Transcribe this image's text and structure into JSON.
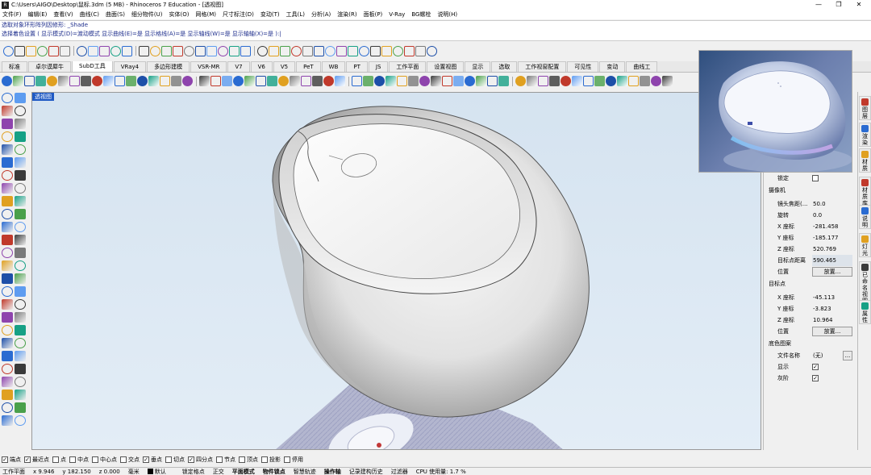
{
  "window": {
    "title": "C:\\Users\\AIGO\\Desktop\\鼠标.3dm (5 MB) - Rhinoceros 7 Education - [透视图]",
    "controls": [
      "—",
      "❐",
      "✕"
    ]
  },
  "menu": [
    "文件(F)",
    "编辑(E)",
    "查看(V)",
    "曲线(C)",
    "曲面(S)",
    "细分物件(U)",
    "实体(O)",
    "网格(M)",
    "尺寸标注(D)",
    "变动(T)",
    "工具(L)",
    "分析(A)",
    "渲染(R)",
    "面板(P)",
    "V-Ray",
    "BG螺栓",
    "说明(H)"
  ],
  "command": {
    "history": "选取对象环形阵列因修形: _Shade",
    "prompt": "选择着色设置 ( 显示模式(D)=渡动模式  显示曲线(E)=是  显示格线(A)=是  显示轴线(W)=是  显示轴轴(X)=是 ):"
  },
  "tabs": [
    "标准",
    "卓尔谟犀牛",
    "SubD工具",
    "VRay4",
    "多边形建模",
    "VSR-MR",
    "V7",
    "V6",
    "V5",
    "PeT",
    "WB",
    "PT",
    "JS",
    "工作平面",
    "设置视图",
    "显示",
    "选取",
    "工作视窗配置",
    "可见性",
    "变动",
    "曲线工"
  ],
  "active_tab_index": 2,
  "viewport": {
    "label": "透视图"
  },
  "properties": {
    "lock_label": "锁定",
    "camera_section": "摄像机",
    "focal_label": "镜头焦距(...",
    "focal_value": "50.0",
    "rotate_label": "旋转",
    "rotate_value": "0.0",
    "cam_x_label": "X 座标",
    "cam_x_value": "-281.458",
    "cam_y_label": "Y 座标",
    "cam_y_value": "-185.177",
    "cam_z_label": "Z 座标",
    "cam_z_value": "520.769",
    "dist_label": "目标点距离",
    "dist_value": "590.465",
    "pos_label": "位置",
    "place_button": "放置...",
    "target_section": "目标点",
    "tgt_x_label": "X 座标",
    "tgt_x_value": "-45.113",
    "tgt_y_label": "Y 座标",
    "tgt_y_value": "-3.823",
    "tgt_z_label": "Z 座标",
    "tgt_z_value": "10.964",
    "tgt_pos_label": "位置",
    "tgt_place_button": "放置...",
    "bg_section": "底色图案",
    "file_label": "文件名称",
    "file_value": "(无)",
    "file_button": "...",
    "show_label": "显示",
    "gray_label": "灰阶"
  },
  "side_tabs": [
    "图层",
    "渲染",
    "材质",
    "材质库",
    "说明",
    "灯光",
    "已命名视图",
    "属性"
  ],
  "snaps": [
    {
      "label": "端点",
      "checked": true
    },
    {
      "label": "最近点",
      "checked": true
    },
    {
      "label": "点",
      "checked": false
    },
    {
      "label": "中点",
      "checked": false
    },
    {
      "label": "中心点",
      "checked": false
    },
    {
      "label": "交点",
      "checked": false
    },
    {
      "label": "垂点",
      "checked": true
    },
    {
      "label": "切点",
      "checked": false
    },
    {
      "label": "四分点",
      "checked": true
    },
    {
      "label": "节点",
      "checked": false
    },
    {
      "label": "顶点",
      "checked": false
    },
    {
      "label": "投影",
      "checked": false
    },
    {
      "label": "停用",
      "checked": false
    }
  ],
  "status": {
    "cplane": "工作平面",
    "x": "x 9.946",
    "y": "y 182.150",
    "z": "z 0.000",
    "unit": "毫米",
    "layer": "默认",
    "items": [
      "锁定格点",
      "正交",
      "平面模式",
      "物件锁点",
      "智慧轨迹",
      "操作轴",
      "记录建构历史",
      "过滤器",
      "CPU 使用量: 1.7 %"
    ],
    "bold_items": [
      2,
      3,
      5
    ]
  }
}
